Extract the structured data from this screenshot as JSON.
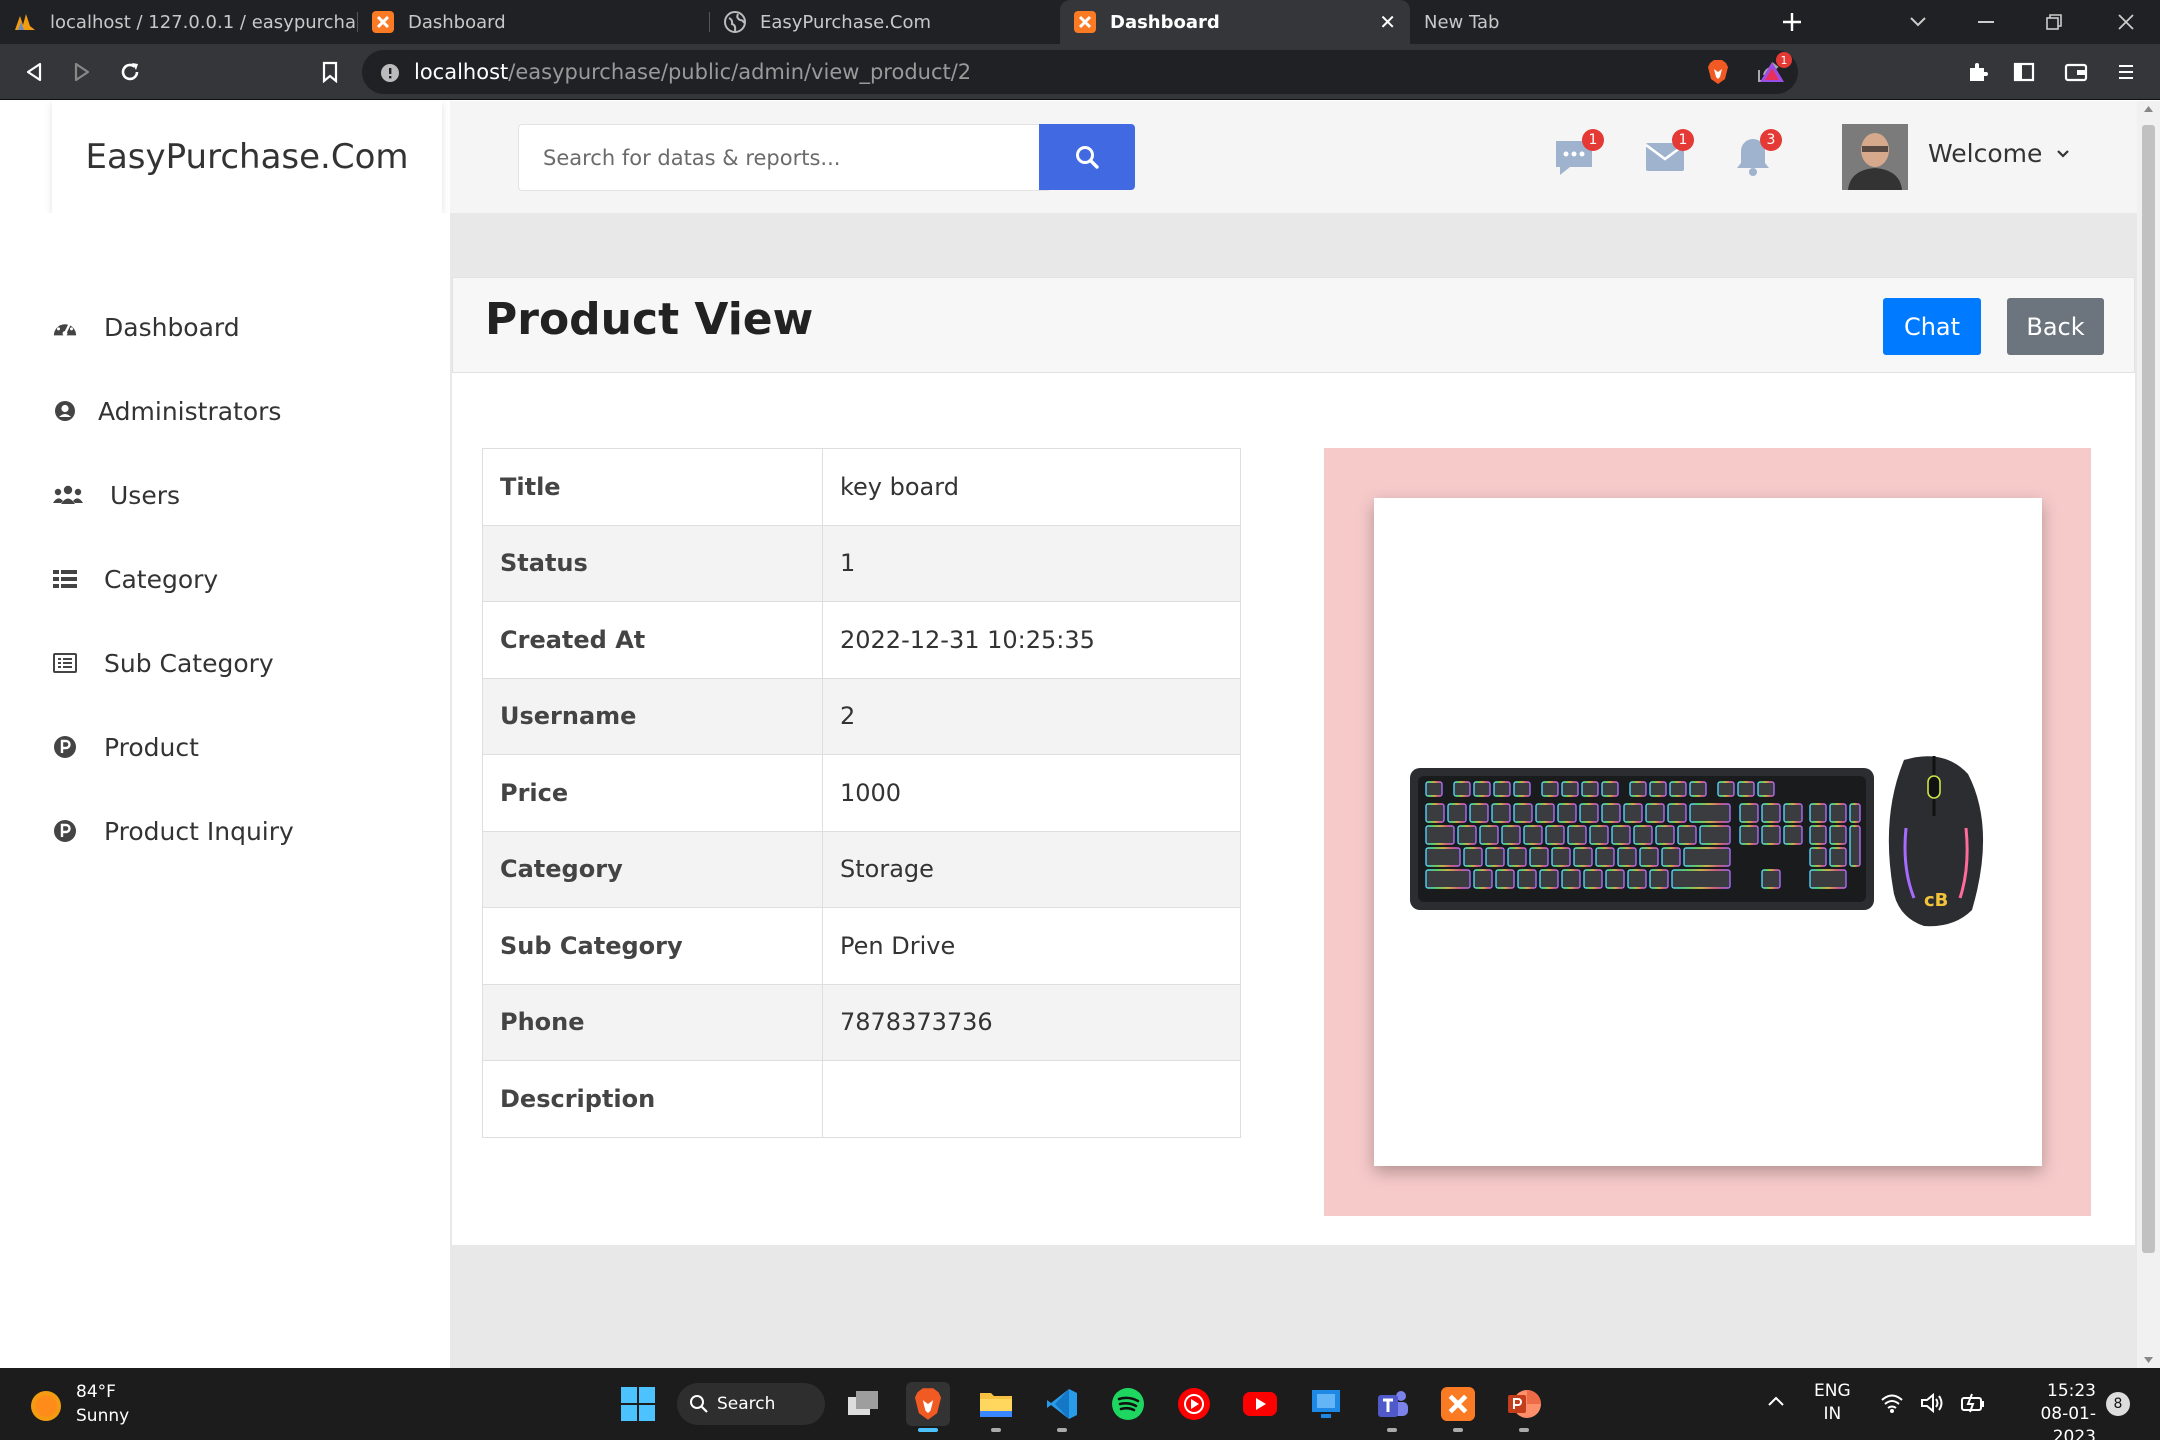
{
  "browser": {
    "tabs": [
      {
        "label": "localhost / 127.0.0.1 / easypurchase /",
        "icon": "phpmyadmin-icon",
        "active": false
      },
      {
        "label": "Dashboard",
        "icon": "xampp-icon",
        "active": false
      },
      {
        "label": "EasyPurchase.Com",
        "icon": "globe-icon",
        "active": false
      },
      {
        "label": "Dashboard",
        "icon": "xampp-icon",
        "active": true
      },
      {
        "label": "New Tab",
        "icon": "",
        "active": false
      }
    ],
    "url_host": "localhost",
    "url_path": "/easypurchase/public/admin/view_product/2",
    "rewards_badge": "1"
  },
  "header": {
    "brand": "EasyPurchase.Com",
    "search_placeholder": "Search for datas & reports...",
    "messages_count": "1",
    "mail_count": "1",
    "notifications_count": "3",
    "welcome": "Welcome"
  },
  "sidebar": {
    "items": [
      {
        "label": "Dashboard",
        "icon": "speedometer-icon"
      },
      {
        "label": "Administrators",
        "icon": "user-circle-icon"
      },
      {
        "label": "Users",
        "icon": "users-icon"
      },
      {
        "label": "Category",
        "icon": "list-icon"
      },
      {
        "label": "Sub Category",
        "icon": "list-alt-icon"
      },
      {
        "label": "Product",
        "icon": "p-circle-icon"
      },
      {
        "label": "Product Inquiry",
        "icon": "p-circle-icon"
      }
    ]
  },
  "main": {
    "title": "Product View",
    "chat_label": "Chat",
    "back_label": "Back",
    "fields": [
      {
        "label": "Title",
        "value": "key board"
      },
      {
        "label": "Status",
        "value": "1"
      },
      {
        "label": "Created At",
        "value": "2022-12-31 10:25:35"
      },
      {
        "label": "Username",
        "value": "2"
      },
      {
        "label": "Price",
        "value": "1000"
      },
      {
        "label": "Category",
        "value": "Storage"
      },
      {
        "label": "Sub Category",
        "value": "Pen Drive"
      },
      {
        "label": "Phone",
        "value": "7878373736"
      },
      {
        "label": "Description",
        "value": ""
      }
    ],
    "image_frame_color": "#f7caca",
    "product_image": "keyboard-and-mouse-image"
  },
  "taskbar": {
    "weather_temp": "84°F",
    "weather_desc": "Sunny",
    "search_label": "Search",
    "lang_top": "ENG",
    "lang_bottom": "IN",
    "time": "15:23",
    "date": "08-01-2023",
    "notification_count": "8"
  },
  "colors": {
    "accent": "#4169e1",
    "chat_button": "#007bff",
    "back_button": "#6c757d"
  }
}
